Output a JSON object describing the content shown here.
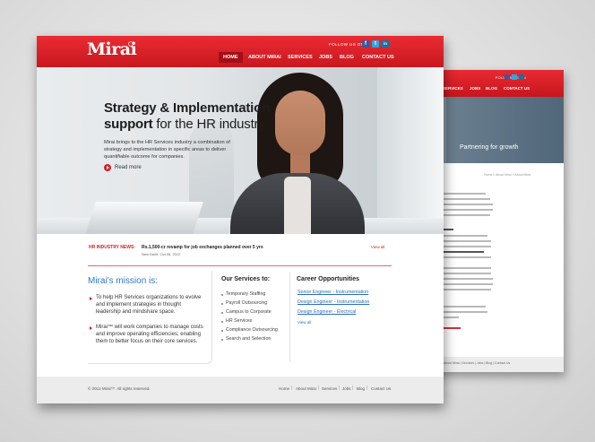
{
  "brand": {
    "logo_text": "Mirai",
    "accent": "#d3202a",
    "link_color": "#2d79c7"
  },
  "header": {
    "follow_label": "FOLLOW US ON",
    "social": [
      {
        "icon": "facebook-icon",
        "glyph": "f"
      },
      {
        "icon": "twitter-icon",
        "glyph": "t"
      },
      {
        "icon": "linkedin-icon",
        "glyph": "in"
      }
    ],
    "nav": [
      {
        "label": "HOME",
        "active": true
      },
      {
        "label": "ABOUT MIRAI"
      },
      {
        "label": "SERVICES"
      },
      {
        "label": "JOBS"
      },
      {
        "label": "BLOG"
      },
      {
        "label": "CONTACT US"
      }
    ]
  },
  "hero": {
    "title_line1": "Strategy & Implementation",
    "title_line2_bold": "support",
    "title_line2_rest": " for the HR industry",
    "text": "Mirai brings to the HR Services industry a combination of strategy and implementation in specific areas to deliver quantifiable outcome for companies.",
    "read_more": "Read more"
  },
  "news": {
    "label": "HR INDUSTRY NEWS:",
    "headline": "Rs.1,500-cr revamp for job exchanges planned over 5 yrs",
    "date": "New Delhi, Oct 06, 2012",
    "view_all": "View all"
  },
  "mission": {
    "title": "Mirai's mission is:",
    "items": [
      "To help HR Services organizations to evolve and implement strategies in thought leadership and mindshare space.",
      "Mirai™ will work companies to manage costs and improve operating efficiencies; enabling them to better focus on their core services."
    ]
  },
  "services": {
    "title": "Our Services to:",
    "items": [
      "Temporary Staffing",
      "Payroll Outsourcing",
      "Campus to Corporate",
      "HR Services",
      "Compliance Outsourcing",
      "Search and Selection"
    ]
  },
  "careers": {
    "title": "Career Opportunities",
    "items": [
      "Senior Engineer - Instrumentation",
      "Design Engineer - Instrumentation",
      "Design Engineer - Electrical"
    ],
    "view_all": "View all"
  },
  "footer": {
    "copyright": "© 2012 Mirai™. All rights reserved.",
    "links": [
      "Home",
      "About Mirai",
      "Services",
      "Jobs",
      "Blog",
      "Contact Us"
    ]
  },
  "back_page": {
    "follow_label": "FOLLOW US ON",
    "nav": [
      "SERVICES",
      "JOBS",
      "BLOG",
      "CONTACT US"
    ],
    "banner_title": "Partnering for growth",
    "breadcrumb": "Home » About Mirai » About Mirai",
    "footer_links": "About Mirai | Services | Jobs | Blog | Contact Us"
  }
}
